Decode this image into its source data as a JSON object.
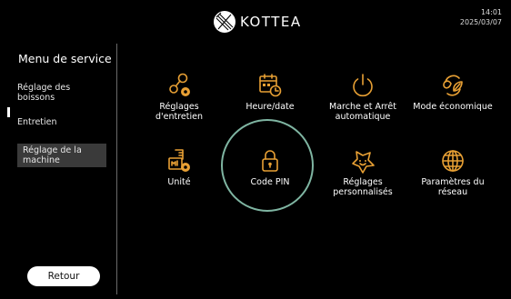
{
  "header": {
    "brand": "KOTTEA",
    "time": "14:01",
    "date": "2025/03/07"
  },
  "sidebar": {
    "title": "Menu de service",
    "items": [
      {
        "label": "Réglage des boissons",
        "active": false
      },
      {
        "label": "Entretien",
        "active": false
      },
      {
        "label": "Réglage de la machine",
        "active": true
      }
    ],
    "back_label": "Retour"
  },
  "grid": [
    {
      "label": "Réglages d'entretien",
      "icon": "maintenance-settings-icon"
    },
    {
      "label": "Heure/date",
      "icon": "calendar-clock-icon"
    },
    {
      "label": "Marche et Arrêt automatique",
      "icon": "power-icon"
    },
    {
      "label": "Mode économique",
      "icon": "eco-leaf-icon"
    },
    {
      "label": "Unité",
      "icon": "measuring-unit-icon"
    },
    {
      "label": "Code PIN",
      "icon": "lock-icon",
      "selected": true
    },
    {
      "label": "Réglages personnalisés",
      "icon": "star-icon"
    },
    {
      "label": "Paramètres du réseau",
      "icon": "globe-icon"
    }
  ],
  "colors": {
    "accent": "#e8a034",
    "selection_ring": "#7fb5a2",
    "background": "#000000"
  }
}
